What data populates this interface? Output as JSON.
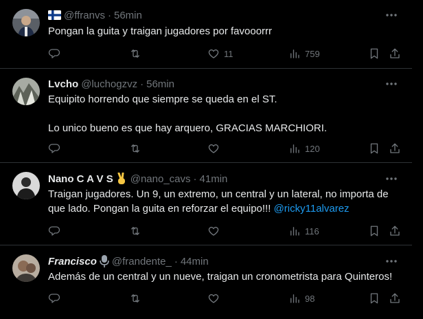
{
  "tweets": [
    {
      "name": "",
      "handle": "@ffranvs",
      "time": "56min",
      "lines": [
        "Pongan la guita y traigan jugadores por favooorrr"
      ],
      "replies": "",
      "retweets": "",
      "likes": "11",
      "views": "759",
      "badge_icon": "finland-flag-icon"
    },
    {
      "name": "Lvcho",
      "handle": "@luchogzvz",
      "time": "56min",
      "lines": [
        "Equipito horrendo que siempre se queda en el ST.",
        "",
        "Lo unico bueno es que hay arquero, GRACIAS MARCHIORI."
      ],
      "replies": "",
      "retweets": "",
      "likes": "",
      "views": "120"
    },
    {
      "name": "Nano C A V S",
      "handle": "@nano_cavs",
      "time": "41min",
      "lines": [
        "Traigan jugadores. Un 9, un extremo, un central y un lateral, no importa de",
        "que lado. Pongan la guita en reforzar el equipo!!! "
      ],
      "mention": "@ricky11alvarez",
      "replies": "",
      "retweets": "",
      "likes": "",
      "views": "116",
      "badge_icon": "victory-hand-emoji-icon"
    },
    {
      "name": "Francisco",
      "handle": "@frandente_",
      "time": "44min",
      "lines": [
        "Además de un central y un nueve, traigan un cronometrista para Quinteros!"
      ],
      "replies": "",
      "retweets": "",
      "likes": "",
      "views": "98",
      "badge_icon": "microphone-emoji-icon"
    }
  ],
  "separator": "·",
  "colors": {
    "background": "#000000",
    "text": "#e7e9ea",
    "muted": "#71767b",
    "link": "#1d9bf0",
    "divider": "#2f3336"
  }
}
